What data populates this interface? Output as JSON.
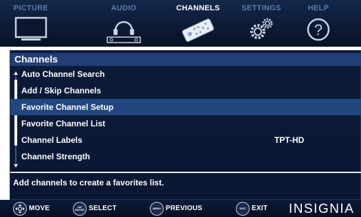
{
  "tabs": [
    {
      "label": "PICTURE",
      "icon": "tv-icon",
      "active": false
    },
    {
      "label": "AUDIO",
      "icon": "headphones-icon",
      "active": false
    },
    {
      "label": "CHANNELS",
      "icon": "remote-control-icon",
      "active": true
    },
    {
      "label": "SETTINGS",
      "icon": "gears-icon",
      "active": false
    },
    {
      "label": "HELP",
      "icon": "question-mark-icon",
      "active": false
    }
  ],
  "panel": {
    "title": "Channels",
    "items": [
      {
        "label": "Auto Channel Search",
        "value": ""
      },
      {
        "label": "Add / Skip Channels",
        "value": ""
      },
      {
        "label": "Favorite Channel Setup",
        "value": "",
        "selected": true
      },
      {
        "label": "Favorite Channel List",
        "value": ""
      },
      {
        "label": "Channel Labels",
        "value": "TPT-HD"
      },
      {
        "label": "Channel Strength",
        "value": ""
      }
    ],
    "help_text": "Add channels to create a favorites list."
  },
  "footer": {
    "hints": [
      {
        "label": "MOVE",
        "key": "dpad-icon"
      },
      {
        "label": "SELECT",
        "key": "ok-enter-icon",
        "key_text": [
          "OK",
          "ENTER"
        ]
      },
      {
        "label": "PREVIOUS",
        "key": "menu-icon",
        "key_text": [
          "MENU"
        ]
      },
      {
        "label": "EXIT",
        "key": "exit-icon",
        "key_text": [
          "EXIT"
        ]
      }
    ],
    "brand": "INSIGNIA"
  },
  "colors": {
    "background": "#0a1733",
    "selected_row": "#21477e",
    "title_bar": "#233e74",
    "inactive_tab_text": "#5d7bb0"
  }
}
